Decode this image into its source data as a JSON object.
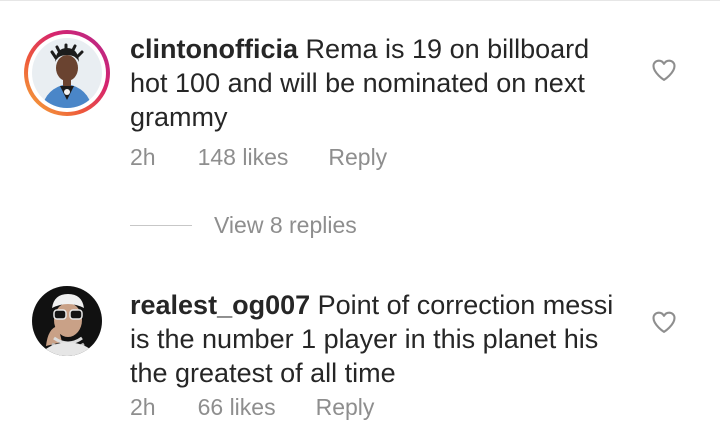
{
  "comments": [
    {
      "username": "clintonofficia",
      "text": "Rema is 19 on billboard hot 100 and will be nominated on next grammy",
      "time": "2h",
      "likes": "148 likes",
      "reply_label": "Reply",
      "has_story_ring": true
    },
    {
      "username": "realest_og007",
      "text": "Point of correction messi is the number 1 player in this planet his the greatest of all time",
      "time": "2h",
      "likes": "66 likes",
      "reply_label": "Reply",
      "has_story_ring": false
    }
  ],
  "view_replies": {
    "label": "View 8 replies"
  },
  "icons": {
    "like": "heart-outline-icon"
  },
  "colors": {
    "text": "#262626",
    "secondary": "#8e8e8e",
    "story_ring": "#d6246e"
  }
}
